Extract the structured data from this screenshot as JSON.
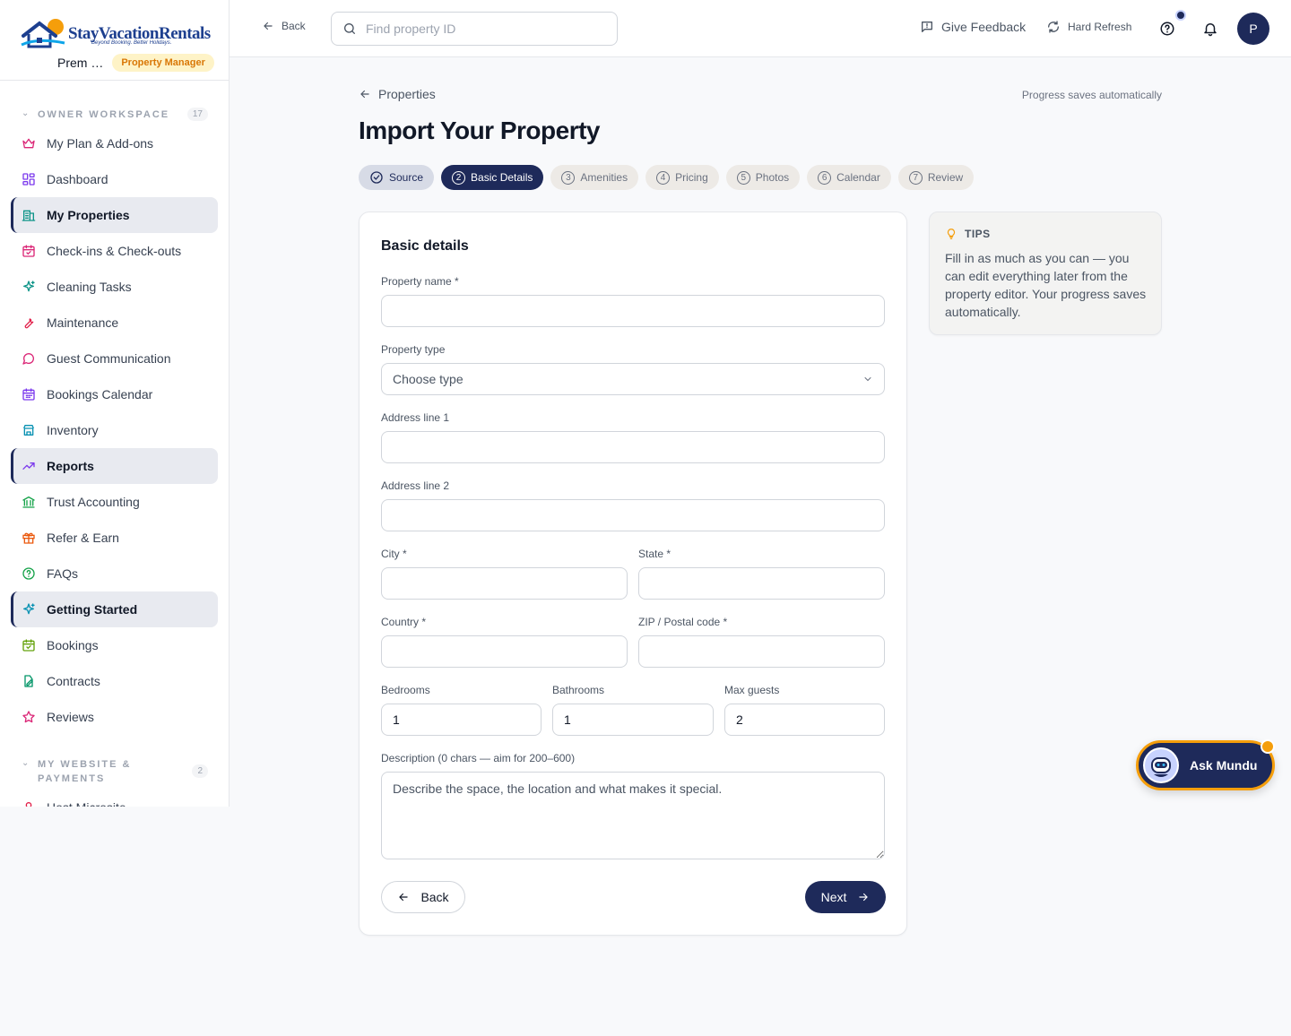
{
  "brand": {
    "name": "StayVacationRentals",
    "tagline": "Beyond Booking. Better Holidays."
  },
  "user": {
    "name": "Prem …",
    "role": "Property Manager",
    "initial": "P"
  },
  "sidebar": {
    "sections": [
      {
        "label": "OWNER WORKSPACE",
        "count": "17"
      },
      {
        "label": "MY WEBSITE & PAYMENTS",
        "count": "2"
      }
    ],
    "items": [
      {
        "label": "My Plan & Add-ons",
        "icon": "crown-icon",
        "color": "#db2777"
      },
      {
        "label": "Dashboard",
        "icon": "dashboard-icon",
        "color": "#7c3aed"
      },
      {
        "label": "My Properties",
        "icon": "building-icon",
        "color": "#0d9488",
        "active": true
      },
      {
        "label": "Check-ins & Check-outs",
        "icon": "calendar-check-icon",
        "color": "#db2777"
      },
      {
        "label": "Cleaning Tasks",
        "icon": "sparkles-icon",
        "color": "#0d9488"
      },
      {
        "label": "Maintenance",
        "icon": "wrench-icon",
        "color": "#e11d48"
      },
      {
        "label": "Guest Communication",
        "icon": "message-icon",
        "color": "#db2777"
      },
      {
        "label": "Bookings Calendar",
        "icon": "calendar-icon",
        "color": "#7c3aed"
      },
      {
        "label": "Inventory",
        "icon": "store-icon",
        "color": "#0891b2"
      },
      {
        "label": "Reports",
        "icon": "trending-up-icon",
        "color": "#7c3aed",
        "active": true
      },
      {
        "label": "Trust Accounting",
        "icon": "bank-icon",
        "color": "#16a34a"
      },
      {
        "label": "Refer & Earn",
        "icon": "gift-icon",
        "color": "#ea580c"
      },
      {
        "label": "FAQs",
        "icon": "help-circle-icon",
        "color": "#16a34a"
      },
      {
        "label": "Getting Started",
        "icon": "sparkles-icon",
        "color": "#0891b2",
        "active": true
      },
      {
        "label": "Bookings",
        "icon": "calendar-check-icon",
        "color": "#65a30d"
      },
      {
        "label": "Contracts",
        "icon": "contract-icon",
        "color": "#059669"
      },
      {
        "label": "Reviews",
        "icon": "star-icon",
        "color": "#db2777"
      },
      {
        "label": "Host Microsite",
        "icon": "user-icon",
        "color": "#e11d48"
      }
    ]
  },
  "topbar": {
    "back_label": "Back",
    "search_placeholder": "Find property ID",
    "feedback_label": "Give Feedback",
    "refresh_label": "Hard Refresh"
  },
  "page": {
    "breadcrumb": "Properties",
    "autosave_note": "Progress saves automatically",
    "title": "Import Your Property"
  },
  "steps": [
    {
      "num": "",
      "label": "Source",
      "state": "done"
    },
    {
      "num": "2",
      "label": "Basic Details",
      "state": "current"
    },
    {
      "num": "3",
      "label": "Amenities",
      "state": "todo"
    },
    {
      "num": "4",
      "label": "Pricing",
      "state": "todo"
    },
    {
      "num": "5",
      "label": "Photos",
      "state": "todo"
    },
    {
      "num": "6",
      "label": "Calendar",
      "state": "todo"
    },
    {
      "num": "7",
      "label": "Review",
      "state": "todo"
    }
  ],
  "form": {
    "title": "Basic details",
    "property_name_label": "Property name *",
    "property_name_value": "",
    "property_type_label": "Property type",
    "property_type_value": "Choose type",
    "address1_label": "Address line 1",
    "address1_value": "",
    "address2_label": "Address line 2",
    "address2_value": "",
    "city_label": "City *",
    "city_value": "",
    "state_label": "State *",
    "state_value": "",
    "country_label": "Country *",
    "country_value": "",
    "zip_label": "ZIP / Postal code *",
    "zip_value": "",
    "bedrooms_label": "Bedrooms",
    "bedrooms_value": "1",
    "bathrooms_label": "Bathrooms",
    "bathrooms_value": "1",
    "max_guests_label": "Max guests",
    "max_guests_value": "2",
    "description_label": "Description (0 chars — aim for 200–600)",
    "description_placeholder": "Describe the space, the location and what makes it special.",
    "back_label": "Back",
    "next_label": "Next"
  },
  "tips": {
    "heading": "TIPS",
    "body": "Fill in as much as you can — you can edit everything later from the property editor. Your progress saves automatically."
  },
  "assistant": {
    "label": "Ask Mundu"
  },
  "colors": {
    "primary": "#1e2a5a",
    "accent": "#f59e0b",
    "badge_bg": "#fef3c7",
    "badge_text": "#d97706"
  }
}
